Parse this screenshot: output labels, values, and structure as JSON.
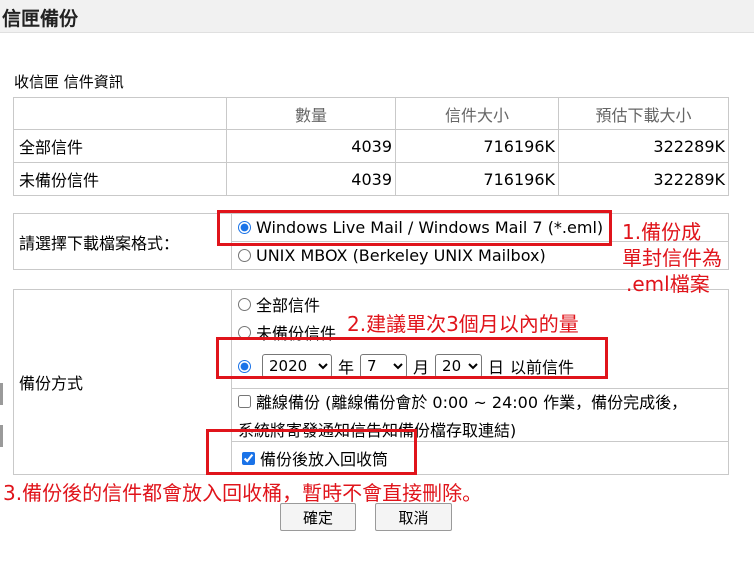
{
  "header": {
    "title": "信匣備份"
  },
  "info": {
    "label": "收信匣 信件資訊",
    "columns": [
      "數量",
      "信件大小",
      "預估下載大小"
    ],
    "rows": [
      {
        "name": "全部信件",
        "count": "4039",
        "size": "716196K",
        "download": "322289K"
      },
      {
        "name": "未備份信件",
        "count": "4039",
        "size": "716196K",
        "download": "322289K"
      }
    ]
  },
  "format": {
    "label": "請選擇下載檔案格式：",
    "options": [
      "Windows Live Mail / Windows Mail 7 (*.eml)",
      "UNIX MBOX (Berkeley UNIX Mailbox)"
    ],
    "selected": 0
  },
  "method": {
    "label": "備份方式",
    "all_label": "全部信件",
    "unbacked_label": "未備份信件",
    "year": "2020",
    "year_suffix": "年",
    "month": "7",
    "month_suffix": "月",
    "day": "20",
    "day_suffix": "日",
    "before_label": "以前信件",
    "offline_line1": "離線備份 (離線備份會於 0:00 ~ 24:00 作業，備份完成後，",
    "offline_line2": "系統將寄發通知信告知備份檔存取連結)",
    "recycle_label": "備份後放入回收筒",
    "recycle_checked": true
  },
  "buttons": {
    "confirm": "確定",
    "cancel": "取消"
  },
  "annotations": {
    "note1_line1": "1.備份成",
    "note1_line2": "單封信件為",
    "note1_line3": ".eml檔案",
    "note2": "2.建議單次3個月以內的量",
    "note3": "3.備份後的信件都會放入回收桶，暫時不會直接刪除。"
  },
  "colors": {
    "annotation": "#e0141b",
    "accent": "#1a73e8"
  }
}
